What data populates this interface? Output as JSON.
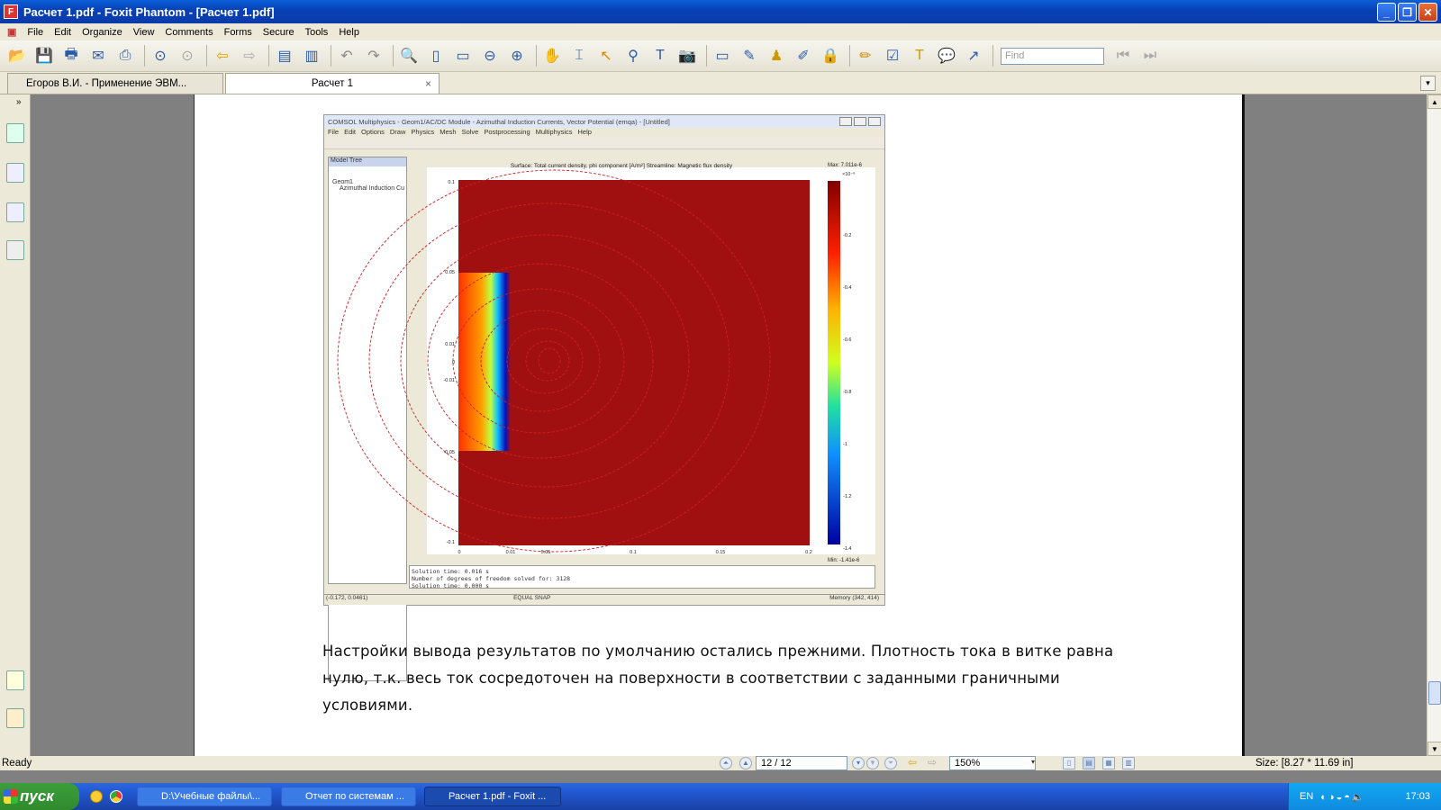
{
  "window": {
    "title": "Расчет 1.pdf - Foxit Phantom - [Расчет 1.pdf]",
    "minimize": "_",
    "restore": "❐",
    "close": "✕"
  },
  "menu": [
    "File",
    "Edit",
    "Organize",
    "View",
    "Comments",
    "Forms",
    "Secure",
    "Tools",
    "Help"
  ],
  "toolbar": {
    "find_placeholder": "Find"
  },
  "tabs": [
    {
      "label": "Егоров В.И. - Применение ЭВМ...",
      "active": false
    },
    {
      "label": "Расчет 1",
      "active": true
    }
  ],
  "tab_close": "×",
  "comsol": {
    "title": "COMSOL Multiphysics - Geom1/AC/DC Module - Azimuthal Induction Currents, Vector Potential (emqa) - [Untitled]",
    "menu": [
      "File",
      "Edit",
      "Options",
      "Draw",
      "Physics",
      "Mesh",
      "Solve",
      "Postprocessing",
      "Multiphysics",
      "Help"
    ],
    "tree_header": "Model Tree",
    "tree_item1": "Geom1",
    "tree_item2": "Azimuthal Induction Cu",
    "log_label": "Geom1",
    "plot_title": "Surface: Total current density, phi component [A/m²]  Streamline: Magnetic flux density",
    "max_label": "Max: 7.011e-6",
    "min_label": "Min: -1.41e-6",
    "colorbar_ticks": [
      "-0.2",
      "-0.4",
      "-0.6",
      "-0.8",
      "-1",
      "-1.2",
      "-1.4"
    ],
    "colorbar_exp": "×10⁻⁶",
    "y_ticks": [
      "0.1",
      "0.05",
      "0.01",
      "0",
      "-0.01",
      "-0.05",
      "-0.1"
    ],
    "x_ticks": [
      "0",
      "0.01",
      "0.05",
      "0.1",
      "0.15",
      "0.2"
    ],
    "status_lines": [
      "Solution time: 0.016 s",
      "Number of degrees of freedom solved for: 3128",
      "Solution time: 0.000 s"
    ],
    "bottom_coords": "(-0.172, 0.0461)",
    "bottom_equal": "EQUAL  SNAP",
    "bottom_memory": "Memory (342, 414)"
  },
  "body_text": [
    "Настройки вывода результатов по умолчанию остались прежними. Плотность тока в витке равна",
    "нулю, т.к. весь ток сосредоточен на поверхности в соответствии с заданными граничными",
    "условиями."
  ],
  "status": {
    "ready": "Ready",
    "page": "12 / 12",
    "zoom": "150%",
    "size": "Size: [8.27 * 11.69 in]"
  },
  "taskbar": {
    "start": "пуск",
    "tasks": [
      {
        "label": "D:\\Учебные файлы\\...",
        "active": false
      },
      {
        "label": "Отчет по системам ...",
        "active": false
      },
      {
        "label": "Расчет 1.pdf - Foxit ...",
        "active": true
      }
    ],
    "lang": "EN",
    "time": "17:03"
  },
  "colors": {
    "plot_red": "#a01010",
    "titlebar": "#0842b8",
    "start_green": "#3c9e3a"
  }
}
